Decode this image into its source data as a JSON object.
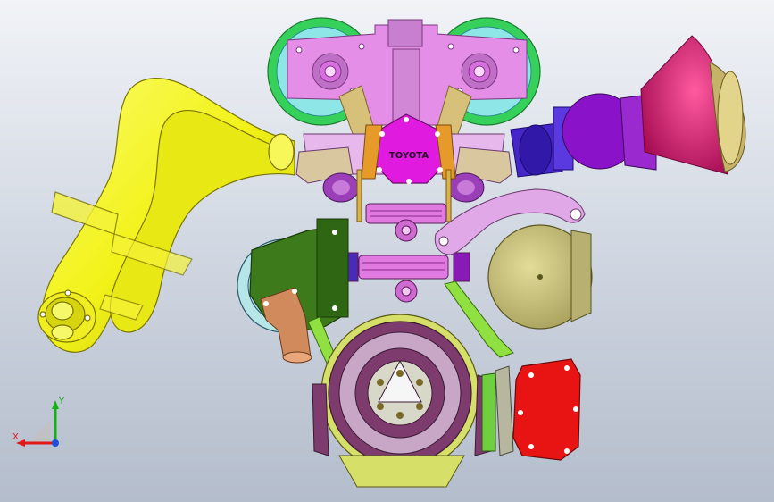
{
  "viewport": {
    "background_top": "#f1f3f7",
    "background_bottom": "#b4bdcc"
  },
  "model": {
    "cam_cover_emblem": "TOYOTA",
    "colors": {
      "exhaust": "#f2f218",
      "cam_cover": "#e48ee8",
      "cam_wheel": "#36d15a",
      "timing_backplate": "#8fe6e6",
      "toyota_cover": "#e01adf",
      "throttle_body": "#4527c9",
      "plenum": "#8a12c8",
      "trumpet": "#d60f6b",
      "trumpet_lip": "#c5b36a",
      "alternator": "#c9c277",
      "water_pump_housing": "#3d7a1c",
      "pump_pulley": "#b7e6e8",
      "copper_elbow": "#d18a5c",
      "flywheel": "#7e3b6e",
      "red_pump": "#e81414",
      "bracket": "#e0a8e6",
      "green_pulley": "#6fcf3f"
    }
  },
  "triad": {
    "x_label": "X",
    "y_label": "Y",
    "x_color": "#e01818",
    "y_color": "#16b016",
    "z_color": "#1f4fd8"
  }
}
